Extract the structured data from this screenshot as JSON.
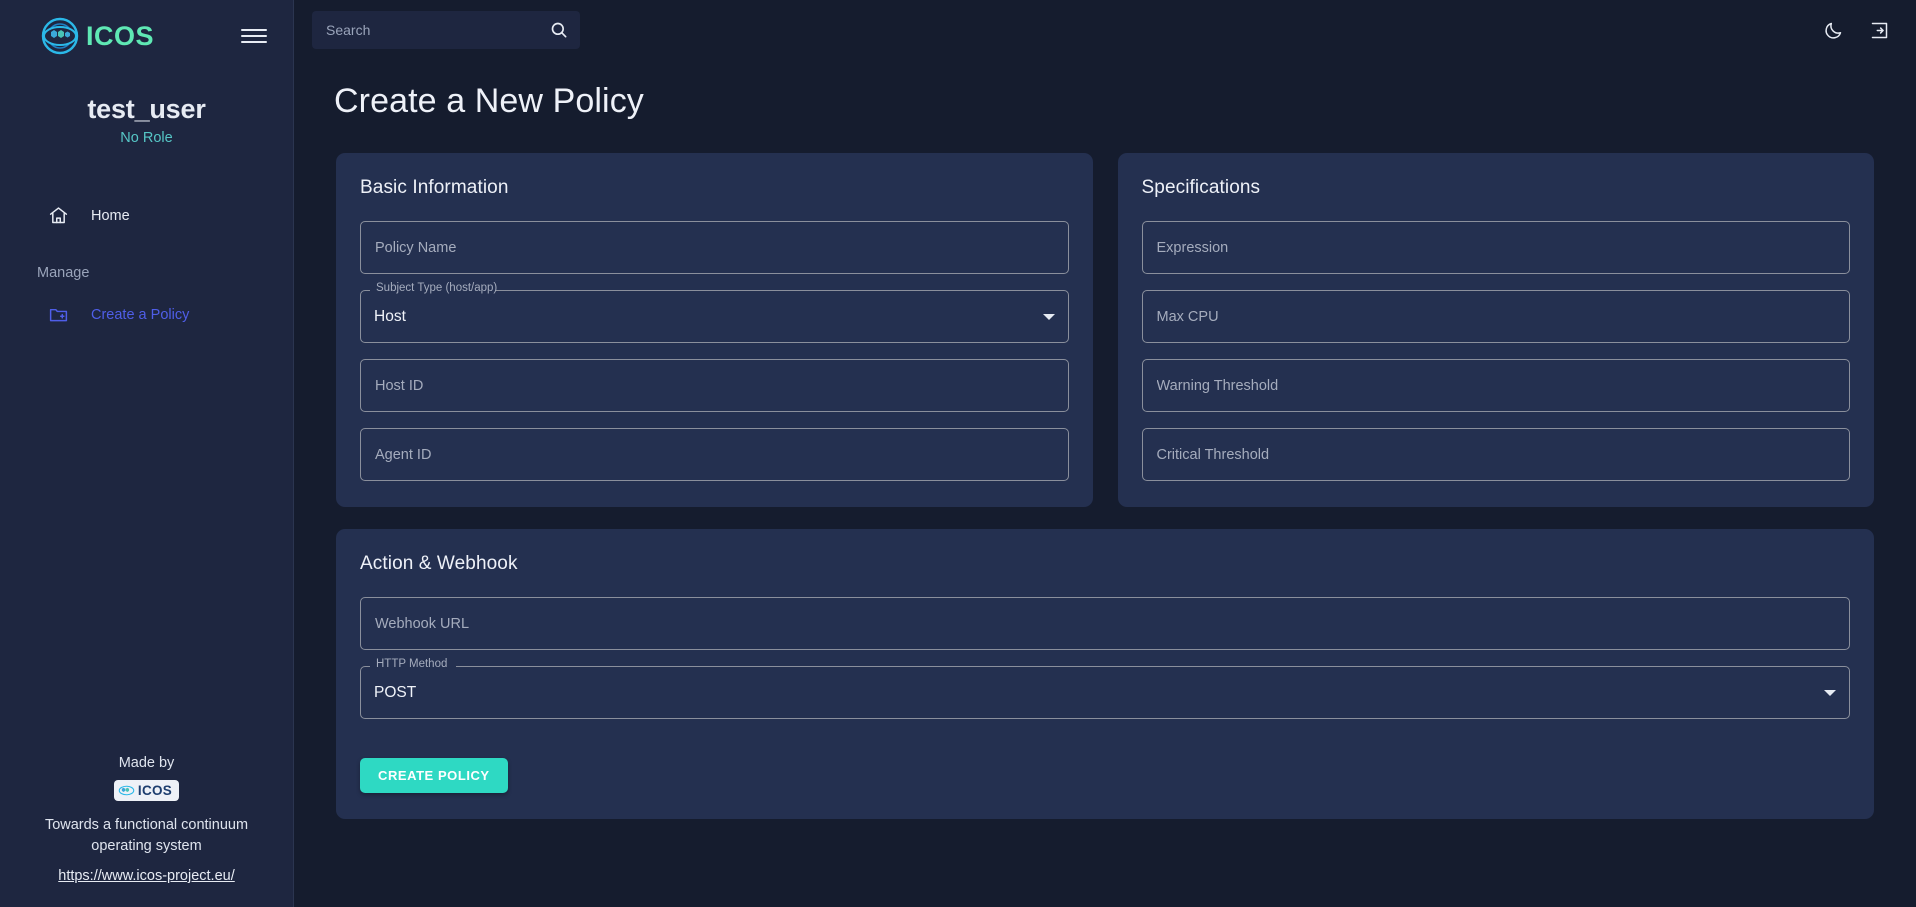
{
  "sidebar": {
    "brand": {
      "name": "ICOS",
      "logo_icon": "icos-cloud-logo-icon"
    },
    "menu_toggle_icon": "hamburger-menu-icon",
    "user": {
      "name": "test_user",
      "role": "No Role"
    },
    "nav": [
      {
        "id": "home",
        "label": "Home",
        "icon": "home-icon"
      }
    ],
    "section_label": "Manage",
    "manage_items": [
      {
        "id": "create-policy",
        "label": "Create a Policy",
        "icon": "folder-plus-icon"
      }
    ],
    "footer": {
      "made_by": "Made by",
      "badge_text": "ICOS",
      "tagline": "Towards a functional continuum operating system",
      "link": "https://www.icos-project.eu/"
    }
  },
  "topbar": {
    "search": {
      "placeholder": "Search",
      "value": "",
      "icon": "search-icon"
    },
    "dark_mode_icon": "moon-icon",
    "logout_icon": "login-arrow-icon"
  },
  "page": {
    "title": "Create a New Policy"
  },
  "cards": {
    "basic_information": {
      "title": "Basic Information",
      "fields": [
        {
          "name": "policy-name",
          "type": "text",
          "placeholder": "Policy Name",
          "value": ""
        },
        {
          "name": "subject-type",
          "type": "select",
          "label": "Subject Type (host/app)",
          "value": "Host"
        },
        {
          "name": "host-id",
          "type": "text",
          "placeholder": "Host ID",
          "value": ""
        },
        {
          "name": "agent-id",
          "type": "text",
          "placeholder": "Agent ID",
          "value": ""
        }
      ]
    },
    "specifications": {
      "title": "Specifications",
      "fields": [
        {
          "name": "expression",
          "type": "text",
          "placeholder": "Expression",
          "value": ""
        },
        {
          "name": "max-cpu",
          "type": "text",
          "placeholder": "Max CPU",
          "value": ""
        },
        {
          "name": "warning-threshold",
          "type": "text",
          "placeholder": "Warning Threshold",
          "value": ""
        },
        {
          "name": "critical-threshold",
          "type": "text",
          "placeholder": "Critical Threshold",
          "value": ""
        }
      ]
    },
    "action_webhook": {
      "title": "Action & Webhook",
      "fields": [
        {
          "name": "webhook-url",
          "type": "text",
          "placeholder": "Webhook URL",
          "value": ""
        },
        {
          "name": "http-method",
          "type": "select",
          "label": "HTTP Method",
          "value": "POST"
        }
      ],
      "submit_label": "CREATE POLICY"
    }
  },
  "colors": {
    "page_bg": "#151c2e",
    "sidebar_bg": "#1e2640",
    "card_bg": "#243050",
    "accent_teal": "#2ed9c3",
    "brand_green": "#5fe8b4",
    "link_indigo": "#4f5ee8",
    "role_cyan": "#56c6c6",
    "field_border": "#8a8f9c",
    "placeholder": "#a5acbd"
  }
}
